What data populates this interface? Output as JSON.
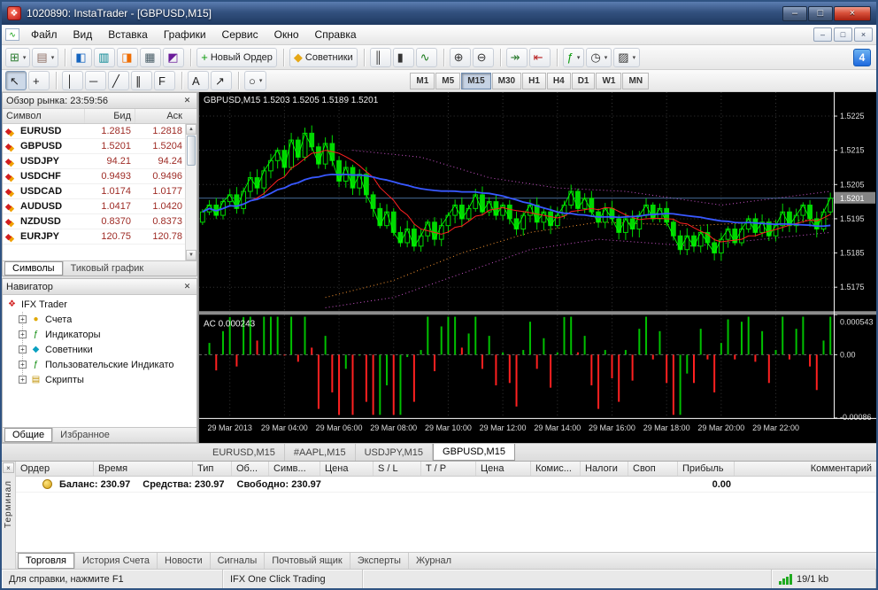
{
  "window": {
    "title": "1020890: InstaTrader - [GBPUSD,M15]",
    "controls": {
      "minimize": "–",
      "maximize": "□",
      "close": "×"
    }
  },
  "menu": {
    "items": [
      {
        "name": "file",
        "label": "Файл"
      },
      {
        "name": "view",
        "label": "Вид"
      },
      {
        "name": "insert",
        "label": "Вставка"
      },
      {
        "name": "charts",
        "label": "Графики"
      },
      {
        "name": "service",
        "label": "Сервис"
      },
      {
        "name": "window",
        "label": "Окно"
      },
      {
        "name": "help",
        "label": "Справка"
      }
    ]
  },
  "toolbar_standard": [
    {
      "name": "new-chart",
      "icon": "new-chart",
      "dropdown": true
    },
    {
      "name": "profiles",
      "icon": "profiles",
      "dropdown": true
    },
    {
      "name": "sep"
    },
    {
      "name": "market-watch-toggle",
      "icon": "market-watch"
    },
    {
      "name": "data-window-toggle",
      "icon": "data-window"
    },
    {
      "name": "navigator-toggle",
      "icon": "navigator"
    },
    {
      "name": "terminal-toggle",
      "icon": "terminal"
    },
    {
      "name": "strategy-tester-toggle",
      "icon": "tester"
    },
    {
      "name": "sep"
    },
    {
      "name": "new-order",
      "icon": "new-order",
      "label": "Новый Ордер"
    },
    {
      "name": "sep"
    },
    {
      "name": "expert-advisors",
      "icon": "experts",
      "label": "Советники"
    },
    {
      "name": "sep"
    },
    {
      "name": "bars-mode",
      "icon": "bars"
    },
    {
      "name": "candles-mode",
      "icon": "candles"
    },
    {
      "name": "line-mode",
      "icon": "line"
    },
    {
      "name": "sep"
    },
    {
      "name": "zoom-in",
      "icon": "zoom-in"
    },
    {
      "name": "zoom-out",
      "icon": "zoom-out"
    },
    {
      "name": "sep"
    },
    {
      "name": "auto-scroll",
      "icon": "auto-scroll"
    },
    {
      "name": "chart-shift",
      "icon": "chart-shift"
    },
    {
      "name": "sep"
    },
    {
      "name": "indicators",
      "icon": "indicators",
      "dropdown": true
    },
    {
      "name": "periods",
      "icon": "periods",
      "dropdown": true
    },
    {
      "name": "templates",
      "icon": "templates",
      "dropdown": true
    }
  ],
  "community_badge": "4",
  "toolbar_line_studies": [
    {
      "name": "cursor",
      "icon": "cursor",
      "pressed": true
    },
    {
      "name": "crosshair",
      "icon": "crosshair"
    },
    {
      "name": "sep"
    },
    {
      "name": "vertical-line",
      "icon": "vline"
    },
    {
      "name": "horizontal-line",
      "icon": "hline"
    },
    {
      "name": "trendline",
      "icon": "trendline"
    },
    {
      "name": "equidistant-channel",
      "icon": "channel"
    },
    {
      "name": "fibonacci",
      "icon": "fibo"
    },
    {
      "name": "sep"
    },
    {
      "name": "text-label",
      "icon": "text"
    },
    {
      "name": "arrow-objects",
      "icon": "arrows"
    },
    {
      "name": "sep"
    },
    {
      "name": "shapes",
      "icon": "shapes",
      "dropdown": true
    }
  ],
  "timeframes": {
    "items": [
      "M1",
      "M5",
      "M15",
      "M30",
      "H1",
      "H4",
      "D1",
      "W1",
      "MN"
    ],
    "active": "M15"
  },
  "market_watch": {
    "title": "Обзор рынка: 23:59:56",
    "columns": [
      "Символ",
      "Бид",
      "Аск"
    ],
    "rows": [
      {
        "symbol": "EURUSD",
        "bid": "1.2815",
        "ask": "1.2818"
      },
      {
        "symbol": "GBPUSD",
        "bid": "1.5201",
        "ask": "1.5204"
      },
      {
        "symbol": "USDJPY",
        "bid": "94.21",
        "ask": "94.24"
      },
      {
        "symbol": "USDCHF",
        "bid": "0.9493",
        "ask": "0.9496"
      },
      {
        "symbol": "USDCAD",
        "bid": "1.0174",
        "ask": "1.0177"
      },
      {
        "symbol": "AUDUSD",
        "bid": "1.0417",
        "ask": "1.0420"
      },
      {
        "symbol": "NZDUSD",
        "bid": "0.8370",
        "ask": "0.8373"
      },
      {
        "symbol": "EURJPY",
        "bid": "120.75",
        "ask": "120.78"
      }
    ],
    "tabs": [
      {
        "name": "symbols",
        "label": "Символы",
        "active": true
      },
      {
        "name": "tick-chart",
        "label": "Тиковый график"
      }
    ]
  },
  "navigator": {
    "title": "Навигатор",
    "root": "IFX Trader",
    "items": [
      {
        "name": "accounts",
        "label": "Счета",
        "icon": "accounts"
      },
      {
        "name": "indicators",
        "label": "Индикаторы",
        "icon": "indicators"
      },
      {
        "name": "expert-advisors",
        "label": "Советники",
        "icon": "experts-tree"
      },
      {
        "name": "custom-indicators",
        "label": "Пользовательские Индикато",
        "icon": "custom-indicators"
      },
      {
        "name": "scripts",
        "label": "Скрипты",
        "icon": "scripts"
      }
    ],
    "tabs": [
      {
        "name": "common",
        "label": "Общие",
        "active": true
      },
      {
        "name": "favorites",
        "label": "Избранное"
      }
    ]
  },
  "chart_tabs": [
    {
      "name": "eurusd",
      "label": "EURUSD,M15"
    },
    {
      "name": "aapl",
      "label": "#AAPL,M15"
    },
    {
      "name": "usdjpy",
      "label": "USDJPY,M15"
    },
    {
      "name": "gbpusd",
      "label": "GBPUSD,M15",
      "active": true
    }
  ],
  "colors": {
    "candle": "#00d800",
    "ma_fast": "#ff2020",
    "ma_slow": "#3858ff",
    "close_line": "#00ff00",
    "cloud_a": "#ff9933",
    "cloud_b": "#cc55cc",
    "bid_line": "#5b8cc8",
    "ac_up": "#00c000",
    "ac_down": "#ff2020",
    "price_badge": "#858585"
  },
  "chart_data": {
    "type": "candlestick",
    "title": "GBPUSD,M15",
    "ohlc_label": "GBPUSD,M15 1.5203 1.5205 1.5189 1.5201",
    "y_ticks": [
      1.5225,
      1.5215,
      1.5205,
      1.5195,
      1.5185,
      1.5175
    ],
    "y_range": [
      1.5168,
      1.5232
    ],
    "current_price": 1.5201,
    "bid_line": 1.5201,
    "x_labels": [
      "29 Mar 2013",
      "29 Mar 04:00",
      "29 Mar 06:00",
      "29 Mar 08:00",
      "29 Mar 10:00",
      "29 Mar 12:00",
      "29 Mar 14:00",
      "29 Mar 16:00",
      "29 Mar 18:00",
      "29 Mar 20:00",
      "29 Mar 22:00"
    ],
    "closes": [
      1.5197,
      1.5199,
      1.5196,
      1.52,
      1.5202,
      1.5198,
      1.5203,
      1.5207,
      1.5204,
      1.5209,
      1.5212,
      1.5215,
      1.521,
      1.5218,
      1.5213,
      1.522,
      1.5216,
      1.5211,
      1.5217,
      1.5212,
      1.5206,
      1.521,
      1.5204,
      1.5208,
      1.5202,
      1.5198,
      1.5193,
      1.5197,
      1.5191,
      1.5188,
      1.5192,
      1.5187,
      1.519,
      1.5194,
      1.5189,
      1.5193,
      1.5196,
      1.5199,
      1.5195,
      1.5198,
      1.5202,
      1.5197,
      1.52,
      1.5196,
      1.5199,
      1.5195,
      1.5192,
      1.5196,
      1.5199,
      1.5194,
      1.5197,
      1.5193,
      1.5196,
      1.5199,
      1.5203,
      1.5198,
      1.5201,
      1.5197,
      1.5194,
      1.5198,
      1.5195,
      1.5191,
      1.5195,
      1.5192,
      1.5196,
      1.5199,
      1.5195,
      1.5198,
      1.5194,
      1.519,
      1.5186,
      1.519,
      1.5187,
      1.5191,
      1.5188,
      1.5185,
      1.5189,
      1.5192,
      1.5188,
      1.5192,
      1.5195,
      1.5191,
      1.5194,
      1.519,
      1.5193,
      1.5197,
      1.5193,
      1.5196,
      1.5199,
      1.5195,
      1.5192,
      1.5197,
      1.5201
    ],
    "cloud_a": [
      [
        18,
        1.5172
      ],
      [
        28,
        1.5177
      ],
      [
        38,
        1.5185
      ],
      [
        48,
        1.5191
      ],
      [
        58,
        1.5194
      ],
      [
        72,
        1.5193
      ],
      [
        92,
        1.5195
      ]
    ],
    "cloud_b": [
      [
        18,
        1.5169
      ],
      [
        28,
        1.5172
      ],
      [
        38,
        1.5179
      ],
      [
        48,
        1.5186
      ],
      [
        58,
        1.5189
      ],
      [
        72,
        1.5187
      ],
      [
        92,
        1.5191
      ]
    ],
    "upper_band": [
      [
        22,
        1.5215
      ],
      [
        32,
        1.5213
      ],
      [
        42,
        1.5207
      ],
      [
        52,
        1.5204
      ],
      [
        62,
        1.5203
      ],
      [
        76,
        1.5199
      ],
      [
        92,
        1.5203
      ]
    ],
    "indicator": {
      "name": "AC",
      "label": "AC 0.000243",
      "range": [
        -0.00086,
        0.000543
      ],
      "ticks": [
        {
          "v": 0.000543,
          "t": "0.000543"
        },
        {
          "v": 0,
          "t": "0.00"
        },
        {
          "v": -0.00086,
          "t": "-0.00086"
        }
      ]
    }
  },
  "terminal": {
    "label": "Терминал",
    "columns": [
      "Ордер",
      "Время",
      "Тип",
      "Об...",
      "Симв...",
      "Цена",
      "S / L",
      "T / P",
      "Цена",
      "Комис...",
      "Налоги",
      "Своп",
      "Прибыль",
      "Комментарий"
    ],
    "balance": "Баланс: 230.97",
    "equity": "Средства: 230.97",
    "free_margin": "Свободно: 230.97",
    "profit": "0.00",
    "tabs": [
      {
        "name": "trade",
        "label": "Торговля",
        "active": true
      },
      {
        "name": "account-history",
        "label": "История Счета"
      },
      {
        "name": "news",
        "label": "Новости"
      },
      {
        "name": "signals",
        "label": "Сигналы"
      },
      {
        "name": "mailbox",
        "label": "Почтовый ящик"
      },
      {
        "name": "experts",
        "label": "Эксперты"
      },
      {
        "name": "journal",
        "label": "Журнал"
      }
    ]
  },
  "status_bar": {
    "help": "Для справки, нажмите F1",
    "one_click": "IFX One Click Trading",
    "traffic": "19/1 kb"
  }
}
